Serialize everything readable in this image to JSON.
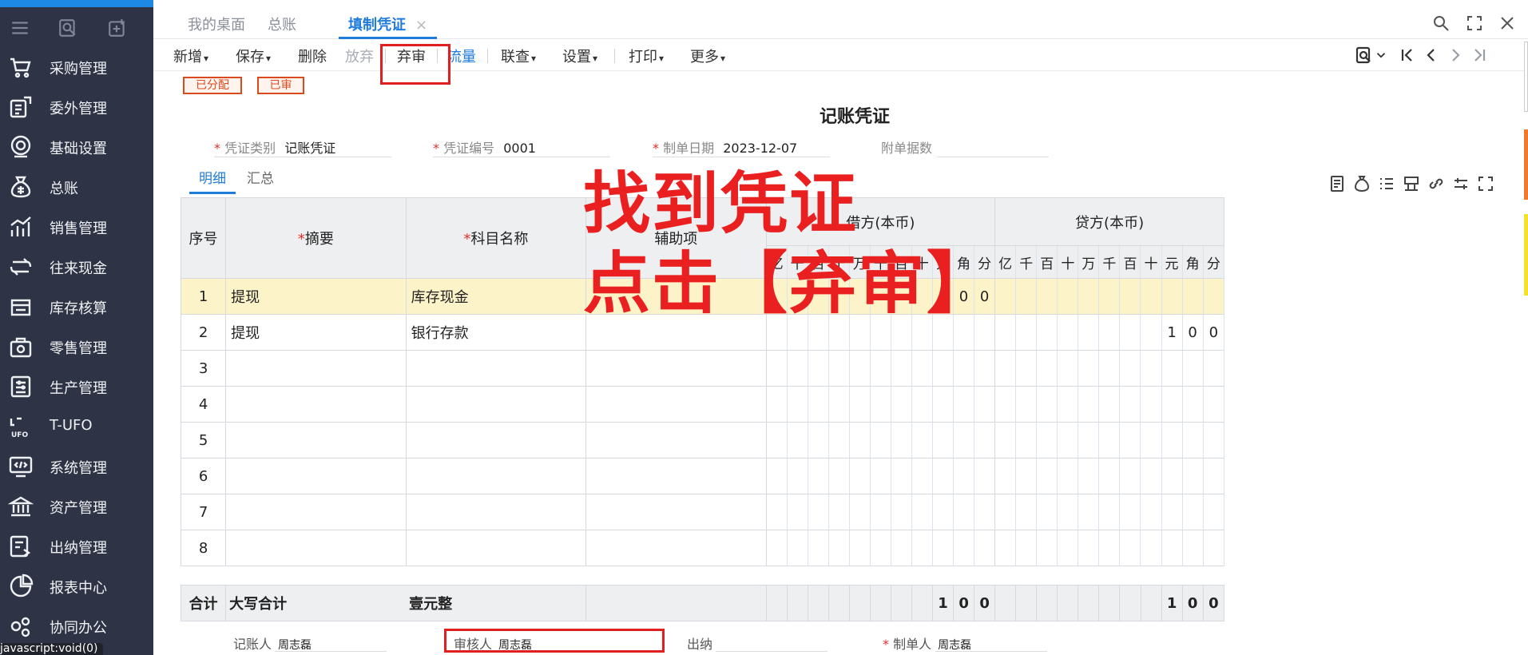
{
  "colors": {
    "accent": "#1f7bdc",
    "sidebar": "#2e3445",
    "annotation": "#ea1f1f",
    "highlight_row": "#fdf3c8",
    "tag": "#d94a1e"
  },
  "sidebar": {
    "items": [
      {
        "label": "采购管理",
        "icon": "cart-icon"
      },
      {
        "label": "委外管理",
        "icon": "outsource-icon"
      },
      {
        "label": "基础设置",
        "icon": "gear-icon"
      },
      {
        "label": "总账",
        "icon": "money-bag-icon"
      },
      {
        "label": "销售管理",
        "icon": "chart-icon"
      },
      {
        "label": "往来现金",
        "icon": "loop-icon"
      },
      {
        "label": "库存核算",
        "icon": "inventory-icon"
      },
      {
        "label": "零售管理",
        "icon": "retail-icon"
      },
      {
        "label": "生产管理",
        "icon": "production-icon"
      },
      {
        "label": "T-UFO",
        "icon": "ufo-icon"
      },
      {
        "label": "系统管理",
        "icon": "code-icon"
      },
      {
        "label": "资产管理",
        "icon": "bank-icon"
      },
      {
        "label": "出纳管理",
        "icon": "cashier-icon"
      },
      {
        "label": "报表中心",
        "icon": "pie-icon"
      },
      {
        "label": "协同办公",
        "icon": "cowork-icon"
      }
    ],
    "status_text": "javascript:void(0)"
  },
  "tabs": [
    {
      "label": "我的桌面"
    },
    {
      "label": "总账"
    },
    {
      "label": "填制凭证",
      "close": "×"
    }
  ],
  "toolbar": {
    "new": "新增",
    "save": "保存",
    "delete": "删除",
    "discard": "放弃",
    "unaudit": "弃审",
    "flow": "流量",
    "link": "联查",
    "settings": "设置",
    "print": "打印",
    "more": "更多"
  },
  "tags": {
    "allocated": "已分配",
    "audited": "已审"
  },
  "voucher": {
    "title": "记账凭证",
    "type_label": "凭证类别",
    "type_value": "记账凭证",
    "no_label": "凭证编号",
    "no_value": "0001",
    "date_label": "制单日期",
    "date_value": "2023-12-07",
    "attach_label": "附单据数",
    "attach_value": ""
  },
  "subtabs": {
    "detail": "明细",
    "summary": "汇总"
  },
  "annotation": {
    "line1": "找到凭证",
    "line2": "点击【弃审】"
  },
  "table": {
    "headers": {
      "seq": "序号",
      "summary": "摘要",
      "account": "科目名称",
      "aux": "辅助项",
      "debit": "借方(本币)",
      "credit": "贷方(本币)"
    },
    "digits": [
      "亿",
      "千",
      "百",
      "十",
      "万",
      "千",
      "百",
      "十",
      "元",
      "角",
      "分"
    ],
    "rows": [
      {
        "no": "1",
        "summary": "提现",
        "account": "库存现金",
        "aux": "",
        "debit": [
          "",
          "",
          "",
          "",
          "",
          "",
          "",
          "",
          "1",
          "0",
          "0"
        ],
        "credit": [
          "",
          "",
          "",
          "",
          "",
          "",
          "",
          "",
          "",
          "",
          ""
        ]
      },
      {
        "no": "2",
        "summary": "提现",
        "account": "银行存款",
        "aux": "",
        "debit": [
          "",
          "",
          "",
          "",
          "",
          "",
          "",
          "",
          "",
          "",
          ""
        ],
        "credit": [
          "",
          "",
          "",
          "",
          "",
          "",
          "",
          "",
          "1",
          "0",
          "0"
        ]
      },
      {
        "no": "3",
        "summary": "",
        "account": "",
        "aux": "",
        "debit": [
          "",
          "",
          "",
          "",
          "",
          "",
          "",
          "",
          "",
          "",
          ""
        ],
        "credit": [
          "",
          "",
          "",
          "",
          "",
          "",
          "",
          "",
          "",
          "",
          ""
        ]
      },
      {
        "no": "4",
        "summary": "",
        "account": "",
        "aux": "",
        "debit": [
          "",
          "",
          "",
          "",
          "",
          "",
          "",
          "",
          "",
          "",
          ""
        ],
        "credit": [
          "",
          "",
          "",
          "",
          "",
          "",
          "",
          "",
          "",
          "",
          ""
        ]
      },
      {
        "no": "5",
        "summary": "",
        "account": "",
        "aux": "",
        "debit": [
          "",
          "",
          "",
          "",
          "",
          "",
          "",
          "",
          "",
          "",
          ""
        ],
        "credit": [
          "",
          "",
          "",
          "",
          "",
          "",
          "",
          "",
          "",
          "",
          ""
        ]
      },
      {
        "no": "6",
        "summary": "",
        "account": "",
        "aux": "",
        "debit": [
          "",
          "",
          "",
          "",
          "",
          "",
          "",
          "",
          "",
          "",
          ""
        ],
        "credit": [
          "",
          "",
          "",
          "",
          "",
          "",
          "",
          "",
          "",
          "",
          ""
        ]
      },
      {
        "no": "7",
        "summary": "",
        "account": "",
        "aux": "",
        "debit": [
          "",
          "",
          "",
          "",
          "",
          "",
          "",
          "",
          "",
          "",
          ""
        ],
        "credit": [
          "",
          "",
          "",
          "",
          "",
          "",
          "",
          "",
          "",
          "",
          ""
        ]
      },
      {
        "no": "8",
        "summary": "",
        "account": "",
        "aux": "",
        "debit": [
          "",
          "",
          "",
          "",
          "",
          "",
          "",
          "",
          "",
          "",
          ""
        ],
        "credit": [
          "",
          "",
          "",
          "",
          "",
          "",
          "",
          "",
          "",
          "",
          ""
        ]
      }
    ],
    "totals": {
      "label": "合计",
      "daxie_label": "大写合计",
      "daxie_value": "壹元整",
      "debit": [
        "",
        "",
        "",
        "",
        "",
        "",
        "",
        "",
        "1",
        "0",
        "0"
      ],
      "credit": [
        "",
        "",
        "",
        "",
        "",
        "",
        "",
        "",
        "1",
        "0",
        "0"
      ]
    }
  },
  "signatures": {
    "bookkeeper_label": "记账人",
    "bookkeeper": "周志磊",
    "auditor_label": "审核人",
    "auditor": "周志磊",
    "cashier_label": "出纳",
    "cashier": "",
    "maker_label": "制单人",
    "maker": "周志磊"
  }
}
